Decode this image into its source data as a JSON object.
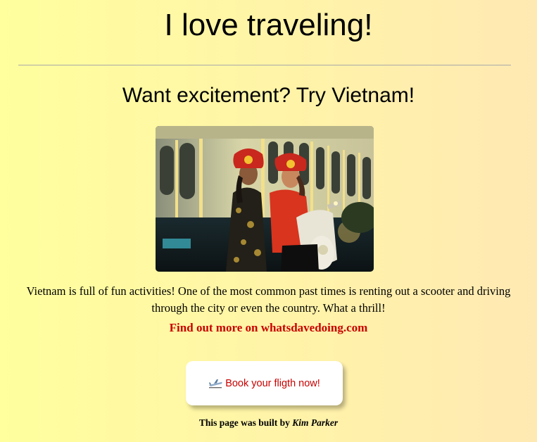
{
  "header": {
    "title": "I love traveling!"
  },
  "section": {
    "heading": "Want excitement? Try Vietnam!",
    "image": {
      "icon": "scooter-photo",
      "alt": ""
    },
    "description": "Vietnam is full of fun activities! One of the most common past times is renting out a scooter and driving through the city or even the country. What a thrill!",
    "link_text": "Find out more on whatsdavedoing.com"
  },
  "cta": {
    "icon": "airplane-icon",
    "label": "Book your fligth now!"
  },
  "footer": {
    "prefix": "This page was built by",
    "author": "Kim Parker"
  },
  "colors": {
    "accent": "#c90000",
    "background_start": "#ffff9e",
    "background_end": "#ffe9b3"
  }
}
